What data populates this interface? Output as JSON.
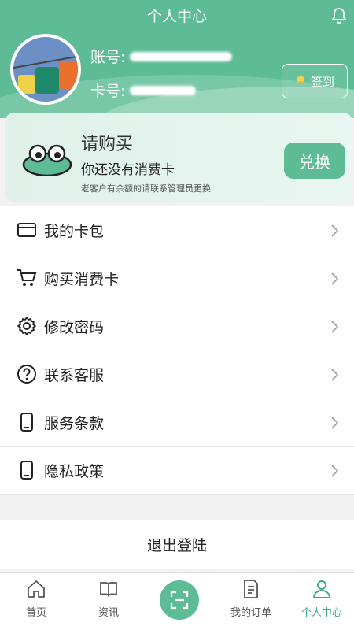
{
  "header": {
    "title": "个人中心",
    "account_label": "账号:",
    "card_label": "卡号:",
    "signin_label": "签到"
  },
  "banner": {
    "title": "请购买",
    "subtitle": "你还没有消费卡",
    "note": "老客户有余额的请联系管理员更换",
    "exchange_label": "兑换"
  },
  "menu": {
    "items": [
      {
        "label": "我的卡包",
        "icon": "card-wallet-icon"
      },
      {
        "label": "购买消费卡",
        "icon": "cart-icon"
      },
      {
        "label": "修改密码",
        "icon": "gear-icon"
      },
      {
        "label": "联系客服",
        "icon": "question-icon"
      },
      {
        "label": "服务条款",
        "icon": "phone-doc-icon"
      },
      {
        "label": "隐私政策",
        "icon": "phone-doc-icon"
      }
    ]
  },
  "logout_label": "退出登陆",
  "tabbar": {
    "tabs": [
      {
        "label": "首页",
        "icon": "home-icon"
      },
      {
        "label": "资讯",
        "icon": "book-icon"
      },
      {
        "label": "",
        "icon": "scan-icon"
      },
      {
        "label": "我的订单",
        "icon": "order-icon"
      },
      {
        "label": "个人中心",
        "icon": "person-icon"
      }
    ],
    "active_index": 4
  },
  "colors": {
    "accent": "#5dbb95",
    "active_tab": "#3daa80"
  }
}
